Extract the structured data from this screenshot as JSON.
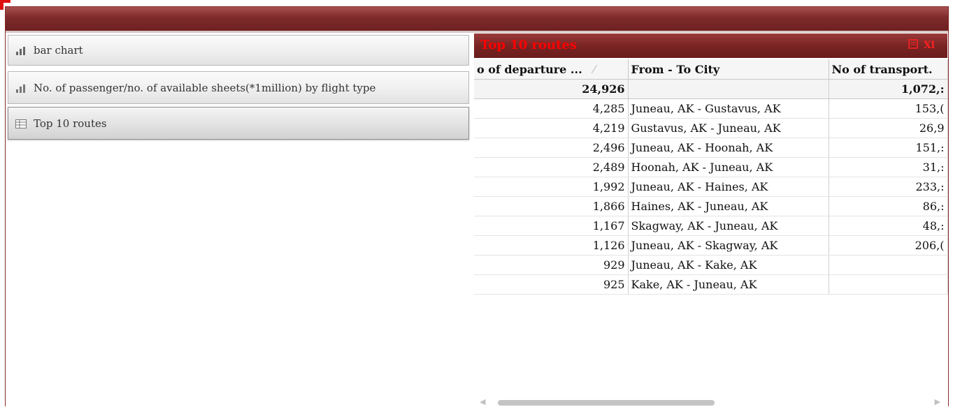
{
  "sidebar": {
    "items": [
      {
        "label": "bar chart",
        "icon": "bar-chart-icon",
        "active": false
      },
      {
        "label": "No. of passenger/no. of available sheets(*1million) by flight type",
        "icon": "bar-chart-icon",
        "active": false
      },
      {
        "label": "Top 10 routes",
        "icon": "table-icon",
        "active": true
      }
    ]
  },
  "table": {
    "title": "Top 10 routes",
    "title_color": "#ff0000",
    "export_icons": [
      "pdf-export-icon",
      "excel-export-icon"
    ],
    "excel_label": "Xl",
    "columns": [
      "o of departure ...",
      "From - To City",
      "No of transport."
    ],
    "total": {
      "departures": "24,926",
      "route": "",
      "transport": "1,072,:"
    },
    "rows": [
      {
        "departures": "4,285",
        "route": "Juneau, AK - Gustavus, AK",
        "transport": "153,("
      },
      {
        "departures": "4,219",
        "route": "Gustavus, AK - Juneau, AK",
        "transport": "26,9"
      },
      {
        "departures": "2,496",
        "route": "Juneau, AK - Hoonah, AK",
        "transport": "151,:"
      },
      {
        "departures": "2,489",
        "route": "Hoonah, AK - Juneau, AK",
        "transport": "31,:"
      },
      {
        "departures": "1,992",
        "route": "Juneau, AK - Haines, AK",
        "transport": "233,:"
      },
      {
        "departures": "1,866",
        "route": "Haines, AK - Juneau, AK",
        "transport": "86,:"
      },
      {
        "departures": "1,167",
        "route": "Skagway, AK - Juneau, AK",
        "transport": "48,:"
      },
      {
        "departures": "1,126",
        "route": "Juneau, AK - Skagway, AK",
        "transport": "206,("
      },
      {
        "departures": "929",
        "route": "Juneau, AK - Kake, AK",
        "transport": ""
      },
      {
        "departures": "925",
        "route": "Kake, AK - Juneau, AK",
        "transport": ""
      }
    ]
  },
  "colors": {
    "header_bar": "#7e2a2a",
    "title_red": "#ff0000"
  }
}
